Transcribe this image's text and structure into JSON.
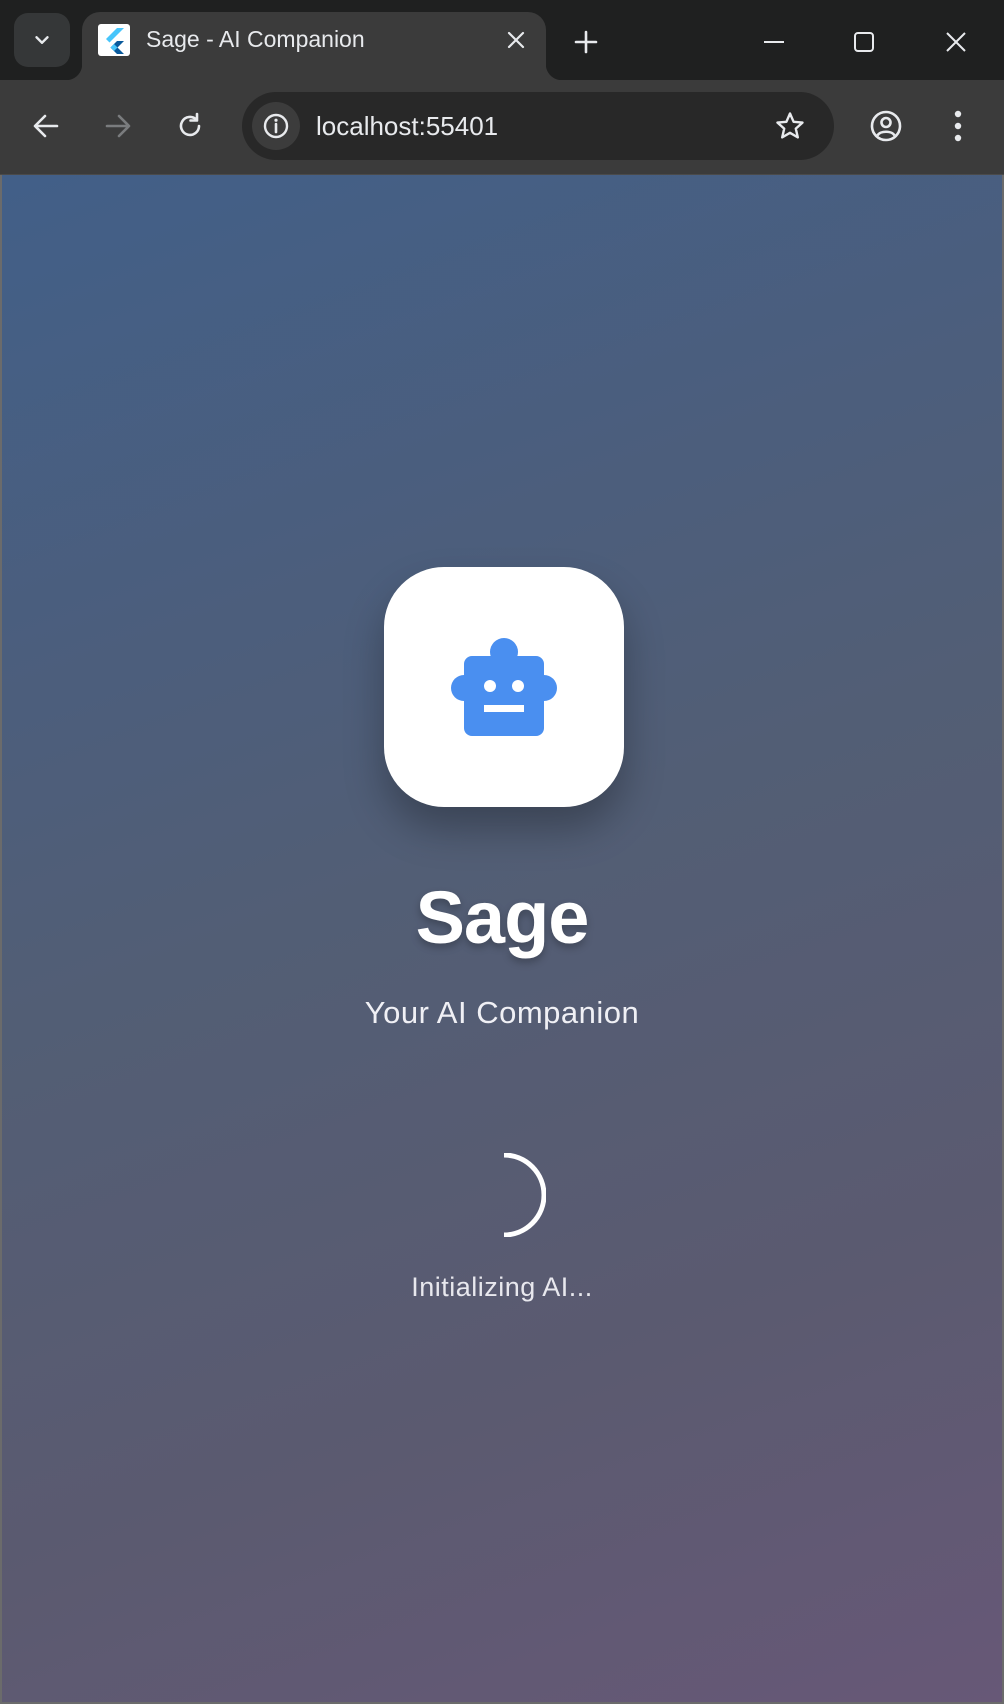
{
  "browser": {
    "tab_title": "Sage - AI Companion",
    "url": "localhost:55401"
  },
  "app": {
    "name": "Sage",
    "tagline": "Your AI Companion",
    "status": "Initializing AI...",
    "icon": "robot-icon",
    "accent_color": "#4a8ff0"
  },
  "colors": {
    "gradient_start": "#425f88",
    "gradient_end": "#675877"
  }
}
